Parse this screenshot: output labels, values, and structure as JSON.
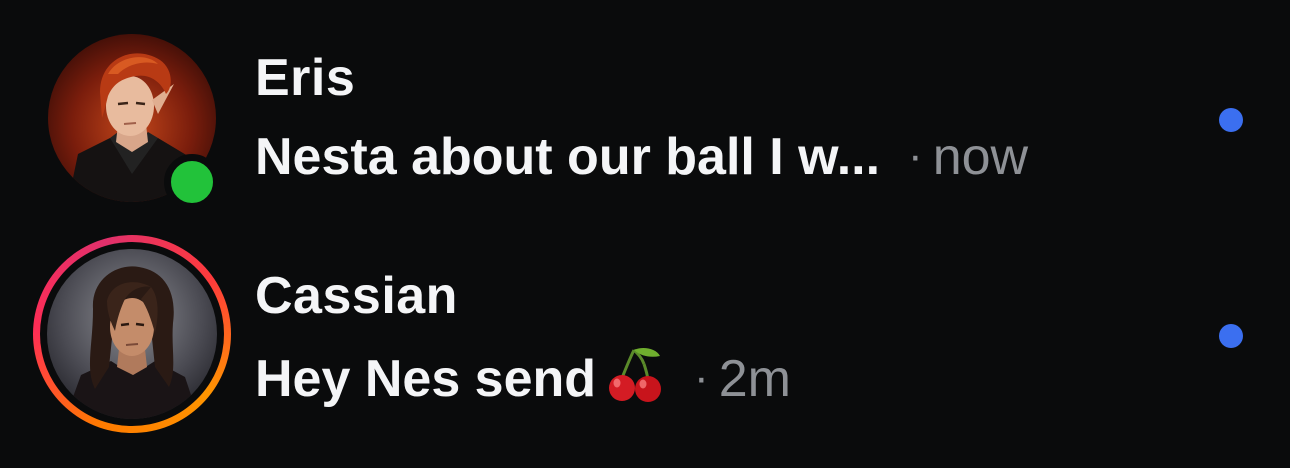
{
  "threads": [
    {
      "name": "Eris",
      "preview": "Nesta about our ball I w...",
      "separator": "·",
      "time": "now",
      "online": true,
      "has_story": false,
      "unread": true
    },
    {
      "name": "Cassian",
      "preview": "Hey Nes send",
      "preview_icon": "cherry-icon",
      "separator": "·",
      "time": "2m",
      "online": false,
      "has_story": true,
      "unread": true
    }
  ],
  "colors": {
    "background": "#0a0b0c",
    "online": "#22c23a",
    "unread": "#3b6ff0",
    "muted_text": "#8e9196"
  }
}
